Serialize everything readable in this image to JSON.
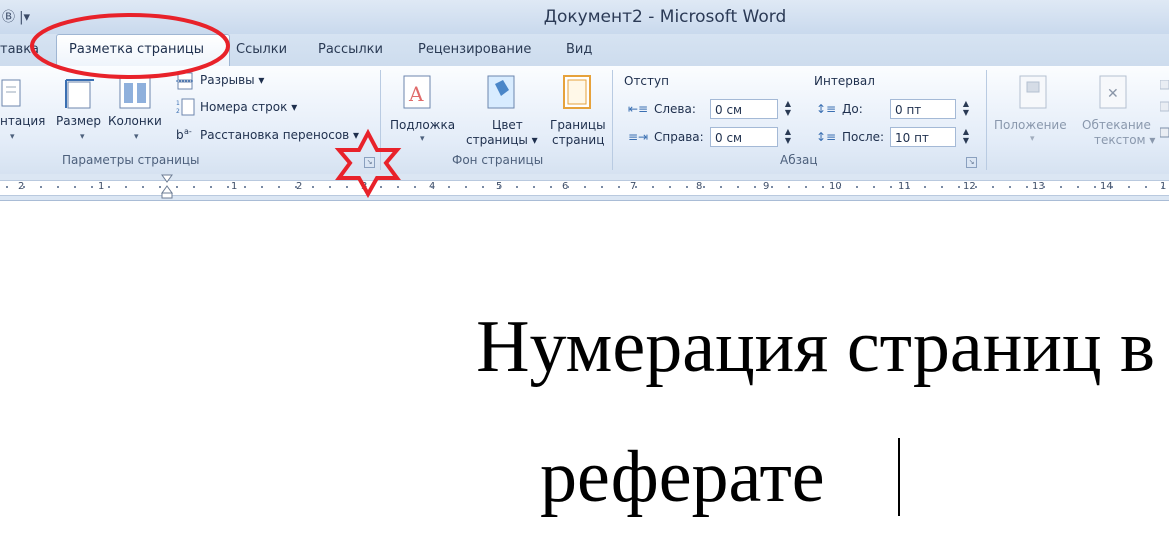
{
  "window": {
    "title": "Документ2 - Microsoft Word",
    "qat": "Ⓑ |▾"
  },
  "tabs": {
    "items": [
      {
        "label": "тавка"
      },
      {
        "label": "Разметка страницы",
        "active": true
      },
      {
        "label": "Ссылки"
      },
      {
        "label": "Рассылки"
      },
      {
        "label": "Рецензирование"
      },
      {
        "label": "Вид"
      }
    ]
  },
  "ribbon": {
    "page_setup": {
      "label": "Параметры страницы",
      "orientation": "нтация",
      "size": "Размер",
      "columns": "Колонки",
      "breaks": "Разрывы ▾",
      "line_numbers": "Номера строк ▾",
      "hyphenation": "Расстановка переносов ▾"
    },
    "page_background": {
      "label": "Фон страницы",
      "watermark": "Подложка",
      "page_color_1": "Цвет",
      "page_color_2": "страницы ▾",
      "borders_1": "Границы",
      "borders_2": "страниц"
    },
    "paragraph": {
      "label": "Абзац",
      "indent_title": "Отступ",
      "left_label": "Слева:",
      "left_value": "0 см",
      "right_label": "Справа:",
      "right_value": "0 см",
      "spacing_title": "Интервал",
      "before_label": "До:",
      "before_value": "0 пт",
      "after_label": "После:",
      "after_value": "10 пт"
    },
    "arrange": {
      "position": "Положение",
      "wrap_1": "Обтекание",
      "wrap_2": "текстом ▾"
    }
  },
  "ruler": {
    "numbers": [
      "2",
      "1",
      "1",
      "2",
      "3",
      "4",
      "5",
      "6",
      "7",
      "8",
      "9",
      "10",
      "11",
      "12",
      "13",
      "14",
      "1"
    ]
  },
  "document": {
    "heading_line1": "Нумерация страниц в",
    "heading_line2": "реферате"
  },
  "colors": {
    "annotation": "#e8222a",
    "ribbon_text": "#1e2f4d"
  }
}
